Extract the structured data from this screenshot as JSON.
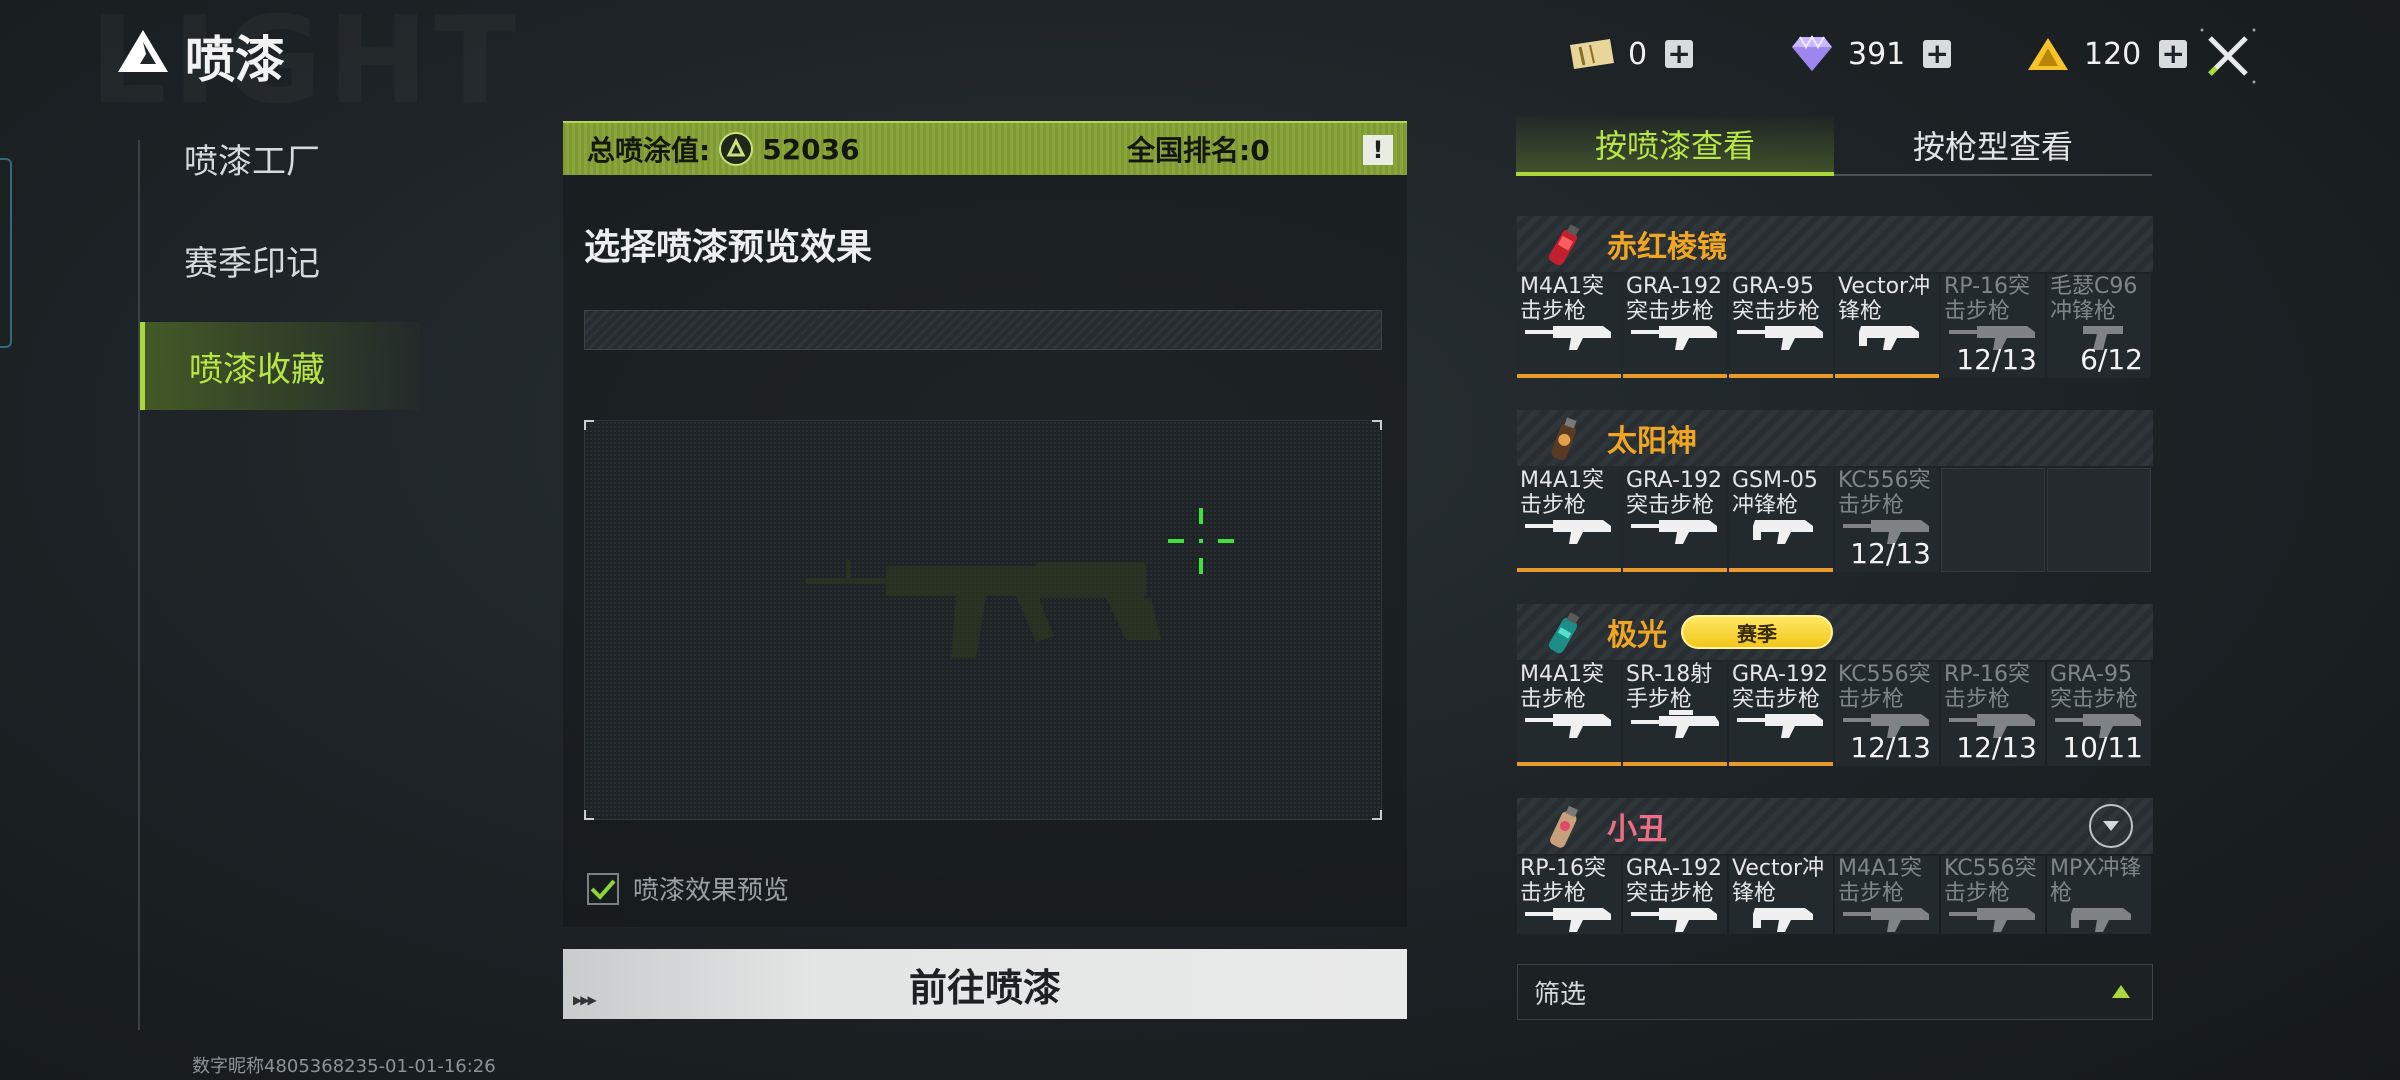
{
  "header": {
    "title": "喷漆",
    "watermark": "LIGHT",
    "currencies": [
      {
        "icon": "ticket-icon",
        "value": "0"
      },
      {
        "icon": "diamond-icon",
        "value": "391"
      },
      {
        "icon": "triangle-coin-icon",
        "value": "120"
      }
    ]
  },
  "nav": {
    "items": [
      {
        "label": "喷漆工厂",
        "active": false
      },
      {
        "label": "赛季印记",
        "active": false
      },
      {
        "label": "喷漆收藏",
        "active": true
      }
    ]
  },
  "footer": {
    "player_id": "数字昵称4805368235-01-01-16:26"
  },
  "score": {
    "label": "总喷涂值:",
    "value": "52036",
    "rank_label": "全国排名:0",
    "info": "!"
  },
  "preview": {
    "title": "选择喷漆预览效果",
    "checkbox_label": "喷漆效果预览",
    "checkbox_checked": true
  },
  "go_button": {
    "label": "前往喷漆"
  },
  "tabs": [
    {
      "label": "按喷漆查看",
      "active": true
    },
    {
      "label": "按枪型查看",
      "active": false
    }
  ],
  "groups": [
    {
      "name": "赤红棱镜",
      "color": "#f0a623",
      "icon": "red-spray-can-icon",
      "badge": "",
      "items": [
        {
          "name": "M4A1突击步枪",
          "progress": "",
          "owned": true
        },
        {
          "name": "GRA-192突击步枪",
          "progress": "",
          "owned": true
        },
        {
          "name": "GRA-95突击步枪",
          "progress": "",
          "owned": true
        },
        {
          "name": "Vector冲锋枪",
          "progress": "",
          "owned": true
        },
        {
          "name": "RP-16突击步枪",
          "progress": "12/13",
          "owned": false
        },
        {
          "name": "毛瑟C96冲锋枪",
          "progress": "6/12",
          "owned": false
        }
      ]
    },
    {
      "name": "太阳神",
      "color": "#f0a623",
      "icon": "sun-god-spray-can-icon",
      "badge": "",
      "items": [
        {
          "name": "M4A1突击步枪",
          "progress": "",
          "owned": true
        },
        {
          "name": "GRA-192突击步枪",
          "progress": "",
          "owned": true
        },
        {
          "name": "GSM-05冲锋枪",
          "progress": "",
          "owned": true
        },
        {
          "name": "KC556突击步枪",
          "progress": "12/13",
          "owned": false
        }
      ]
    },
    {
      "name": "极光",
      "color": "#f0a623",
      "icon": "aurora-spray-can-icon",
      "badge": "赛季",
      "items": [
        {
          "name": "M4A1突击步枪",
          "progress": "",
          "owned": true
        },
        {
          "name": "SR-18射手步枪",
          "progress": "",
          "owned": true
        },
        {
          "name": "GRA-192突击步枪",
          "progress": "",
          "owned": true
        },
        {
          "name": "KC556突击步枪",
          "progress": "12/13",
          "owned": false
        },
        {
          "name": "RP-16突击步枪",
          "progress": "12/13",
          "owned": false
        },
        {
          "name": "GRA-95突击步枪",
          "progress": "10/11",
          "owned": false
        }
      ]
    },
    {
      "name": "小丑",
      "color": "#ee6e86",
      "icon": "clown-spray-can-icon",
      "badge": "",
      "items": [
        {
          "name": "RP-16突击步枪",
          "progress": "",
          "owned": true
        },
        {
          "name": "GRA-192突击步枪",
          "progress": "",
          "owned": true
        },
        {
          "name": "Vector冲锋枪",
          "progress": "",
          "owned": true
        },
        {
          "name": "M4A1突击步枪",
          "progress": "",
          "owned": false
        },
        {
          "name": "KC556突击步枪",
          "progress": "",
          "owned": false
        },
        {
          "name": "MPX冲锋枪",
          "progress": "",
          "owned": false
        }
      ]
    }
  ],
  "filter": {
    "label": "筛选"
  },
  "colors": {
    "accent_green": "#a8d83a",
    "orange": "#f0a623",
    "pink": "#ee6e86"
  }
}
